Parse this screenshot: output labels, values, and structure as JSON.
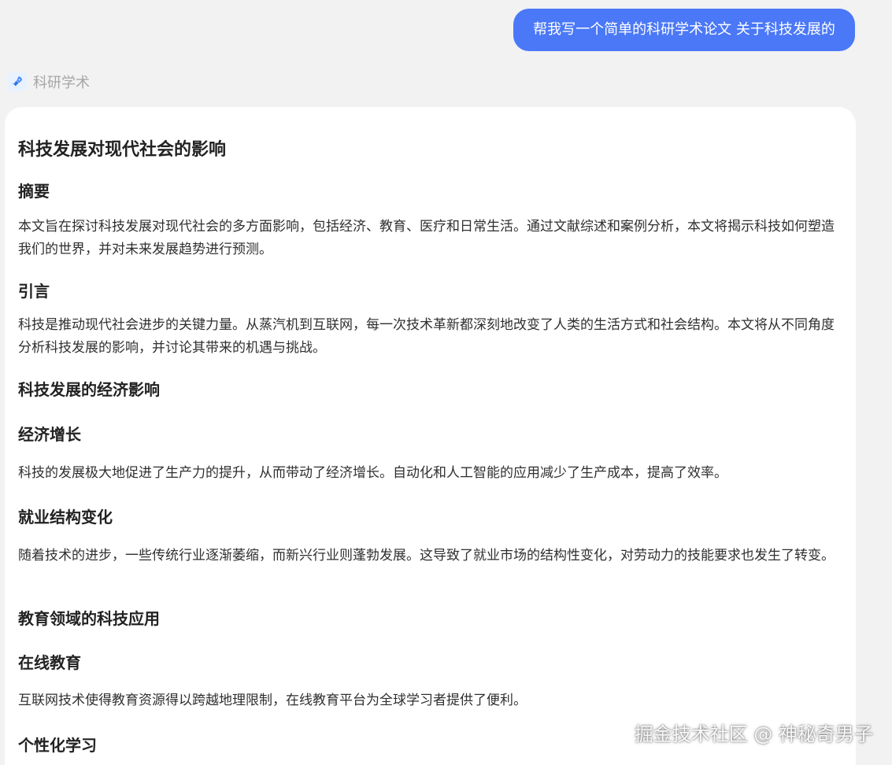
{
  "user_message": "帮我写一个简单的科研学术论文 关于科技发展的",
  "assistant": {
    "name": "科研学术",
    "icon": "rocket-icon"
  },
  "article": {
    "title": "科技发展对现代社会的影响",
    "sections": [
      {
        "heading": "摘要",
        "paragraph": "本文旨在探讨科技发展对现代社会的多方面影响，包括经济、教育、医疗和日常生活。通过文献综述和案例分析，本文将揭示科技如何塑造我们的世界，并对未来发展趋势进行预测。"
      },
      {
        "heading": "引言",
        "paragraph": "科技是推动现代社会进步的关键力量。从蒸汽机到互联网，每一次技术革新都深刻地改变了人类的生活方式和社会结构。本文将从不同角度分析科技发展的影响，并讨论其带来的机遇与挑战。"
      },
      {
        "heading": "科技发展的经济影响"
      },
      {
        "heading": "经济增长",
        "paragraph": "科技的发展极大地促进了生产力的提升，从而带动了经济增长。自动化和人工智能的应用减少了生产成本，提高了效率。"
      },
      {
        "heading": "就业结构变化",
        "paragraph": "随着技术的进步，一些传统行业逐渐萎缩，而新兴行业则蓬勃发展。这导致了就业市场的结构性变化，对劳动力的技能要求也发生了转变。"
      },
      {
        "heading": "教育领域的科技应用"
      },
      {
        "heading": "在线教育",
        "paragraph": "互联网技术使得教育资源得以跨越地理限制，在线教育平台为全球学习者提供了便利。"
      },
      {
        "heading": "个性化学习"
      }
    ]
  },
  "watermark": "掘金技术社区 @ 神秘奇男子",
  "colors": {
    "user_bubble": "#4b78f7",
    "page_bg": "#f2f2f3",
    "card_bg": "#ffffff"
  }
}
